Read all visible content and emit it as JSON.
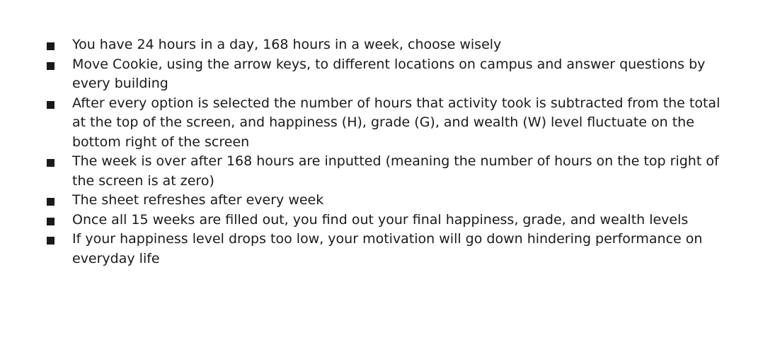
{
  "bullets": [
    "You have 24 hours in a day, 168 hours in a week, choose wisely",
    "Move Cookie, using the arrow keys, to different locations on campus and answer questions by every building",
    "After every option is selected the number of hours that activity took is subtracted from the total at the top of the screen, and happiness (H), grade (G), and wealth (W) level fluctuate on the bottom right of the screen",
    "The week is over after 168 hours are inputted (meaning the number of hours on the top right of the screen is at zero)",
    "The sheet refreshes after every week",
    "Once all 15 weeks are filled out, you find out your final happiness, grade, and wealth levels",
    "If your happiness level drops too low, your motivation will go down hindering performance on everyday life"
  ]
}
